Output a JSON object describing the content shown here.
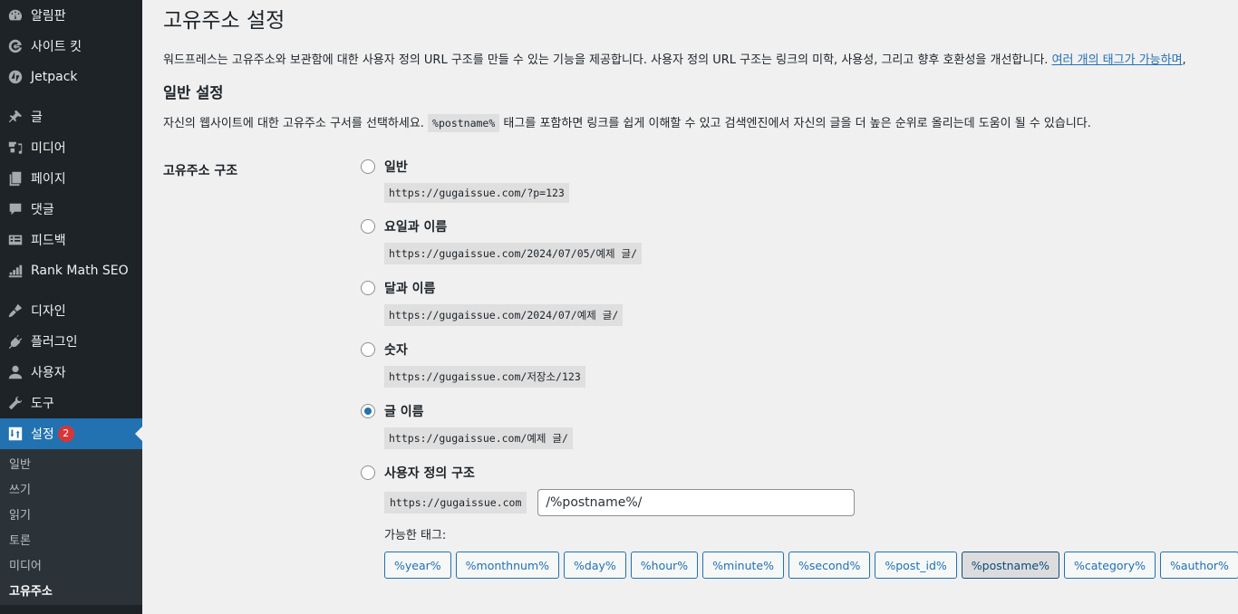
{
  "sidebar": {
    "items": [
      {
        "label": "알림판",
        "icon": "dashboard-icon"
      },
      {
        "label": "사이트 킷",
        "icon": "google-icon"
      },
      {
        "label": "Jetpack",
        "icon": "jetpack-icon"
      },
      {
        "label": "글",
        "icon": "pin-icon"
      },
      {
        "label": "미디어",
        "icon": "media-icon"
      },
      {
        "label": "페이지",
        "icon": "page-icon"
      },
      {
        "label": "댓글",
        "icon": "comment-icon"
      },
      {
        "label": "피드백",
        "icon": "feedback-icon"
      },
      {
        "label": "Rank Math SEO",
        "icon": "rank-math-icon"
      },
      {
        "label": "디자인",
        "icon": "brush-icon"
      },
      {
        "label": "플러그인",
        "icon": "plugin-icon"
      },
      {
        "label": "사용자",
        "icon": "user-icon"
      },
      {
        "label": "도구",
        "icon": "wrench-icon"
      },
      {
        "label": "설정",
        "icon": "settings-icon",
        "badge": "2",
        "current": true
      }
    ],
    "submenu": [
      {
        "label": "일반"
      },
      {
        "label": "쓰기"
      },
      {
        "label": "읽기"
      },
      {
        "label": "토론"
      },
      {
        "label": "미디어"
      },
      {
        "label": "고유주소",
        "current": true
      }
    ]
  },
  "main": {
    "title": "고유주소 설정",
    "intro": "워드프레스는 고유주소와 보관함에 대한 사용자 정의 URL 구조를 만들 수 있는 기능을 제공합니다. 사용자 정의 URL 구조는 링크의 미학, 사용성, 그리고 향후 호환성을 개선합니다. ",
    "intro_link": "여러 개의 태그가 가능하며",
    "intro_tail": ",",
    "section_title": "일반 설정",
    "desc_before": "자신의 웹사이트에 대한 고유주소 구서를 선택하세요. ",
    "desc_code": "%postname%",
    "desc_after": " 태그를 포함하면 링크를 쉽게 이해할 수 있고 검색엔진에서 자신의 글을 더 높은 순위로 올리는데 도움이 될 수 있습니다.",
    "structure_label": "고유주소 구조",
    "options": [
      {
        "label": "일반",
        "example": "https://gugaissue.com/?p=123",
        "checked": false
      },
      {
        "label": "요일과 이름",
        "example": "https://gugaissue.com/2024/07/05/예제 글/",
        "checked": false
      },
      {
        "label": "달과 이름",
        "example": "https://gugaissue.com/2024/07/예제 글/",
        "checked": false
      },
      {
        "label": "숫자",
        "example": "https://gugaissue.com/저장소/123",
        "checked": false
      },
      {
        "label": "글 이름",
        "example": "https://gugaissue.com/예제 글/",
        "checked": true
      }
    ],
    "custom": {
      "label": "사용자 정의 구조",
      "base": "https://gugaissue.com",
      "value": "/%postname%/",
      "available_label": "가능한 태그:",
      "tags": [
        "%year%",
        "%monthnum%",
        "%day%",
        "%hour%",
        "%minute%",
        "%second%",
        "%post_id%",
        "%postname%",
        "%category%",
        "%author%"
      ],
      "active_tag": "%postname%"
    }
  },
  "colors": {
    "accent": "#2271b1",
    "sidebar_bg": "#1d2327",
    "badge": "#d63638"
  }
}
